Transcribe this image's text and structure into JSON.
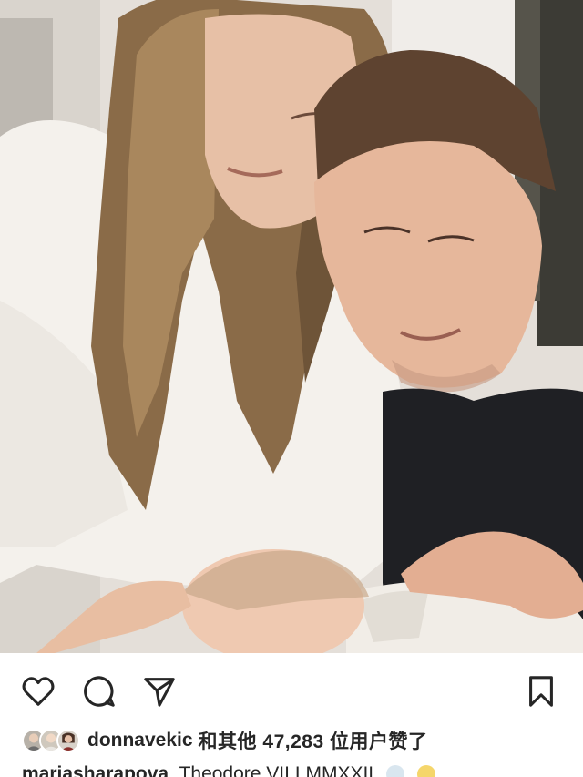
{
  "post": {
    "image_alt": "Family photo: woman and man leaning over a sleeping newborn"
  },
  "actions": {
    "like_icon": "heart-icon",
    "comment_icon": "comment-bubble-icon",
    "share_icon": "paper-plane-icon",
    "save_icon": "bookmark-icon"
  },
  "likes": {
    "username": "donnavekic",
    "text_prefix": "和其他",
    "count": "47,283",
    "text_suffix": "位用户赞了"
  },
  "caption": {
    "username": "mariasharapova",
    "text": "Theodore VII.I.MMXXII"
  },
  "colors": {
    "text": "#262626",
    "background": "#ffffff"
  }
}
